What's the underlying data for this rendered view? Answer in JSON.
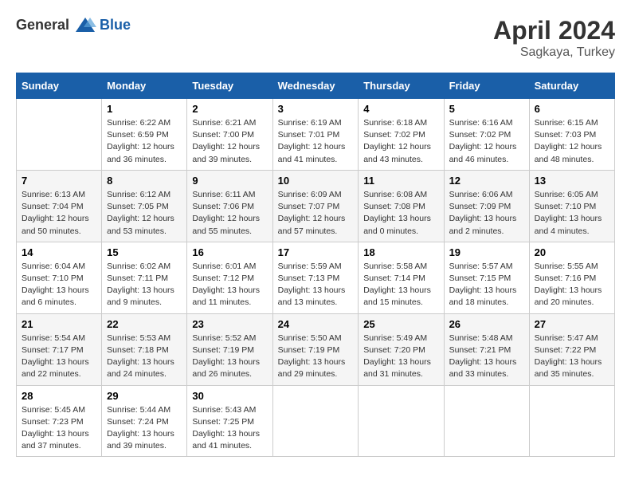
{
  "header": {
    "logo_general": "General",
    "logo_blue": "Blue",
    "title": "April 2024",
    "subtitle": "Sagkaya, Turkey"
  },
  "days_of_week": [
    "Sunday",
    "Monday",
    "Tuesday",
    "Wednesday",
    "Thursday",
    "Friday",
    "Saturday"
  ],
  "weeks": [
    [
      {
        "day": "",
        "empty": true
      },
      {
        "day": "1",
        "sunrise": "Sunrise: 6:22 AM",
        "sunset": "Sunset: 6:59 PM",
        "daylight": "Daylight: 12 hours and 36 minutes."
      },
      {
        "day": "2",
        "sunrise": "Sunrise: 6:21 AM",
        "sunset": "Sunset: 7:00 PM",
        "daylight": "Daylight: 12 hours and 39 minutes."
      },
      {
        "day": "3",
        "sunrise": "Sunrise: 6:19 AM",
        "sunset": "Sunset: 7:01 PM",
        "daylight": "Daylight: 12 hours and 41 minutes."
      },
      {
        "day": "4",
        "sunrise": "Sunrise: 6:18 AM",
        "sunset": "Sunset: 7:02 PM",
        "daylight": "Daylight: 12 hours and 43 minutes."
      },
      {
        "day": "5",
        "sunrise": "Sunrise: 6:16 AM",
        "sunset": "Sunset: 7:02 PM",
        "daylight": "Daylight: 12 hours and 46 minutes."
      },
      {
        "day": "6",
        "sunrise": "Sunrise: 6:15 AM",
        "sunset": "Sunset: 7:03 PM",
        "daylight": "Daylight: 12 hours and 48 minutes."
      }
    ],
    [
      {
        "day": "7",
        "sunrise": "Sunrise: 6:13 AM",
        "sunset": "Sunset: 7:04 PM",
        "daylight": "Daylight: 12 hours and 50 minutes."
      },
      {
        "day": "8",
        "sunrise": "Sunrise: 6:12 AM",
        "sunset": "Sunset: 7:05 PM",
        "daylight": "Daylight: 12 hours and 53 minutes."
      },
      {
        "day": "9",
        "sunrise": "Sunrise: 6:11 AM",
        "sunset": "Sunset: 7:06 PM",
        "daylight": "Daylight: 12 hours and 55 minutes."
      },
      {
        "day": "10",
        "sunrise": "Sunrise: 6:09 AM",
        "sunset": "Sunset: 7:07 PM",
        "daylight": "Daylight: 12 hours and 57 minutes."
      },
      {
        "day": "11",
        "sunrise": "Sunrise: 6:08 AM",
        "sunset": "Sunset: 7:08 PM",
        "daylight": "Daylight: 13 hours and 0 minutes."
      },
      {
        "day": "12",
        "sunrise": "Sunrise: 6:06 AM",
        "sunset": "Sunset: 7:09 PM",
        "daylight": "Daylight: 13 hours and 2 minutes."
      },
      {
        "day": "13",
        "sunrise": "Sunrise: 6:05 AM",
        "sunset": "Sunset: 7:10 PM",
        "daylight": "Daylight: 13 hours and 4 minutes."
      }
    ],
    [
      {
        "day": "14",
        "sunrise": "Sunrise: 6:04 AM",
        "sunset": "Sunset: 7:10 PM",
        "daylight": "Daylight: 13 hours and 6 minutes."
      },
      {
        "day": "15",
        "sunrise": "Sunrise: 6:02 AM",
        "sunset": "Sunset: 7:11 PM",
        "daylight": "Daylight: 13 hours and 9 minutes."
      },
      {
        "day": "16",
        "sunrise": "Sunrise: 6:01 AM",
        "sunset": "Sunset: 7:12 PM",
        "daylight": "Daylight: 13 hours and 11 minutes."
      },
      {
        "day": "17",
        "sunrise": "Sunrise: 5:59 AM",
        "sunset": "Sunset: 7:13 PM",
        "daylight": "Daylight: 13 hours and 13 minutes."
      },
      {
        "day": "18",
        "sunrise": "Sunrise: 5:58 AM",
        "sunset": "Sunset: 7:14 PM",
        "daylight": "Daylight: 13 hours and 15 minutes."
      },
      {
        "day": "19",
        "sunrise": "Sunrise: 5:57 AM",
        "sunset": "Sunset: 7:15 PM",
        "daylight": "Daylight: 13 hours and 18 minutes."
      },
      {
        "day": "20",
        "sunrise": "Sunrise: 5:55 AM",
        "sunset": "Sunset: 7:16 PM",
        "daylight": "Daylight: 13 hours and 20 minutes."
      }
    ],
    [
      {
        "day": "21",
        "sunrise": "Sunrise: 5:54 AM",
        "sunset": "Sunset: 7:17 PM",
        "daylight": "Daylight: 13 hours and 22 minutes."
      },
      {
        "day": "22",
        "sunrise": "Sunrise: 5:53 AM",
        "sunset": "Sunset: 7:18 PM",
        "daylight": "Daylight: 13 hours and 24 minutes."
      },
      {
        "day": "23",
        "sunrise": "Sunrise: 5:52 AM",
        "sunset": "Sunset: 7:19 PM",
        "daylight": "Daylight: 13 hours and 26 minutes."
      },
      {
        "day": "24",
        "sunrise": "Sunrise: 5:50 AM",
        "sunset": "Sunset: 7:19 PM",
        "daylight": "Daylight: 13 hours and 29 minutes."
      },
      {
        "day": "25",
        "sunrise": "Sunrise: 5:49 AM",
        "sunset": "Sunset: 7:20 PM",
        "daylight": "Daylight: 13 hours and 31 minutes."
      },
      {
        "day": "26",
        "sunrise": "Sunrise: 5:48 AM",
        "sunset": "Sunset: 7:21 PM",
        "daylight": "Daylight: 13 hours and 33 minutes."
      },
      {
        "day": "27",
        "sunrise": "Sunrise: 5:47 AM",
        "sunset": "Sunset: 7:22 PM",
        "daylight": "Daylight: 13 hours and 35 minutes."
      }
    ],
    [
      {
        "day": "28",
        "sunrise": "Sunrise: 5:45 AM",
        "sunset": "Sunset: 7:23 PM",
        "daylight": "Daylight: 13 hours and 37 minutes."
      },
      {
        "day": "29",
        "sunrise": "Sunrise: 5:44 AM",
        "sunset": "Sunset: 7:24 PM",
        "daylight": "Daylight: 13 hours and 39 minutes."
      },
      {
        "day": "30",
        "sunrise": "Sunrise: 5:43 AM",
        "sunset": "Sunset: 7:25 PM",
        "daylight": "Daylight: 13 hours and 41 minutes."
      },
      {
        "day": "",
        "empty": true
      },
      {
        "day": "",
        "empty": true
      },
      {
        "day": "",
        "empty": true
      },
      {
        "day": "",
        "empty": true
      }
    ]
  ]
}
